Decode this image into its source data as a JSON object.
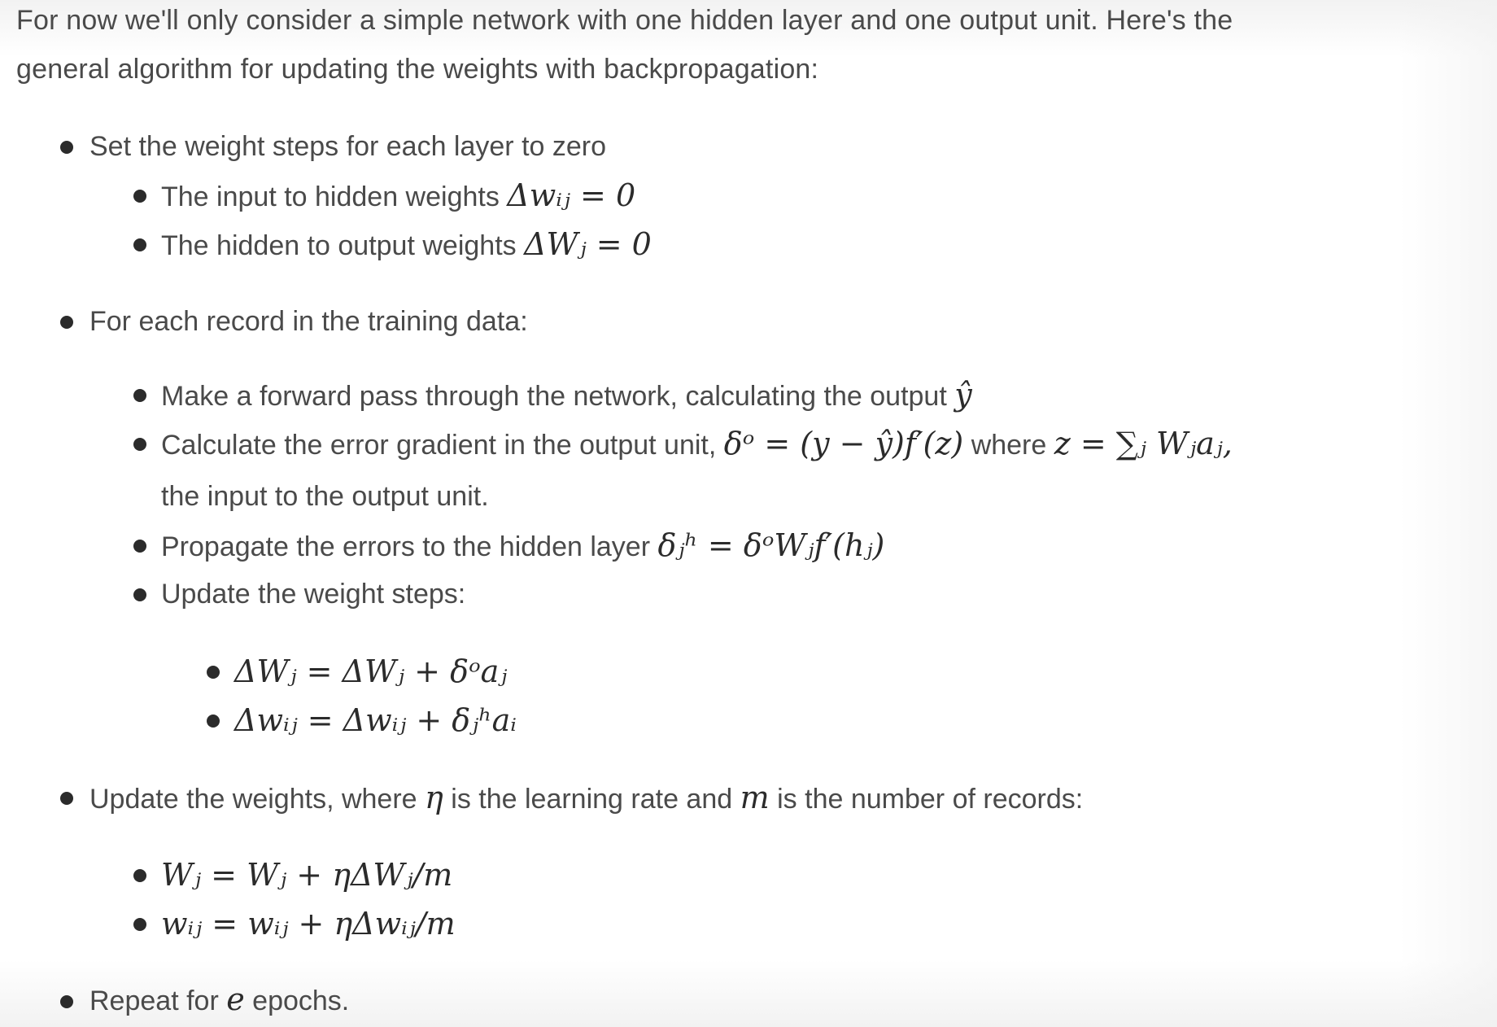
{
  "intro": {
    "line1": "For now we'll only consider a simple network with one hidden layer and one output unit. Here's the",
    "line2": "general algorithm for updating the weights with backpropagation:"
  },
  "steps": {
    "set_zero": {
      "label": "Set the weight steps for each layer to zero",
      "input_hidden_text": "The input to hidden weights",
      "input_hidden_math": "Δwᵢⱼ = 0",
      "hidden_output_text": "The hidden to output weights",
      "hidden_output_math": "ΔWⱼ = 0"
    },
    "each_record": {
      "label": "For each record in the training data:",
      "forward_text": "Make a forward pass through the network, calculating the output",
      "forward_math": "ŷ",
      "error_text": "Calculate the error gradient in the output unit,",
      "error_math": "δᵒ = (y − ŷ)f′(z)",
      "error_where": "where",
      "error_z_math": "z = ∑ⱼ Wⱼaⱼ,",
      "error_cont": "the input to the output unit.",
      "propagate_text": "Propagate the errors to the hidden layer",
      "propagate_math": "δⱼʰ = δᵒWⱼf′(hⱼ)",
      "update_steps_text": "Update the weight steps:",
      "update_W_math": "ΔWⱼ = ΔWⱼ + δᵒaⱼ",
      "update_w_math": "Δwᵢⱼ = Δwᵢⱼ + δⱼʰaᵢ"
    },
    "update_weights": {
      "text_before": "Update the weights, where",
      "eta": "η",
      "text_middle": "is the learning rate and",
      "m": "m",
      "text_after": "is the number of records:",
      "W_math": "Wⱼ = Wⱼ + ηΔWⱼ/m",
      "w_math": "wᵢⱼ = wᵢⱼ + ηΔwᵢⱼ/m"
    },
    "repeat": {
      "text_before": "Repeat for",
      "e": "e",
      "text_after": "epochs."
    }
  }
}
